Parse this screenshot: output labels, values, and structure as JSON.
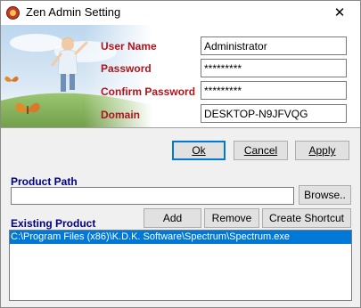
{
  "window": {
    "title": "Zen Admin Setting",
    "close_glyph": "✕"
  },
  "form": {
    "username_label": "User Name",
    "username_value": "Administrator",
    "password_label": "Password",
    "password_value": "*********",
    "confirm_label": "Confirm Password",
    "confirm_value": "*********",
    "domain_label": "Domain",
    "domain_value": "DESKTOP-N9JFVQG"
  },
  "dialog_buttons": {
    "ok_label": "Ok",
    "cancel_label": "Cancel",
    "apply_label": "Apply"
  },
  "product_path": {
    "label": "Product Path",
    "value": "",
    "browse_label": "Browse.."
  },
  "existing": {
    "label": "Existing Product",
    "add_label": "Add",
    "remove_label": "Remove",
    "shortcut_label": "Create Shortcut",
    "items": [
      "C:\\Program Files (x86)\\K.D.K. Software\\Spectrum\\Spectrum.exe"
    ]
  },
  "colors": {
    "label_red": "#b0141c",
    "section_blue": "#000080",
    "selection": "#0078d7"
  },
  "icons": [
    "app-icon",
    "close-icon",
    "butterfly-icon"
  ]
}
